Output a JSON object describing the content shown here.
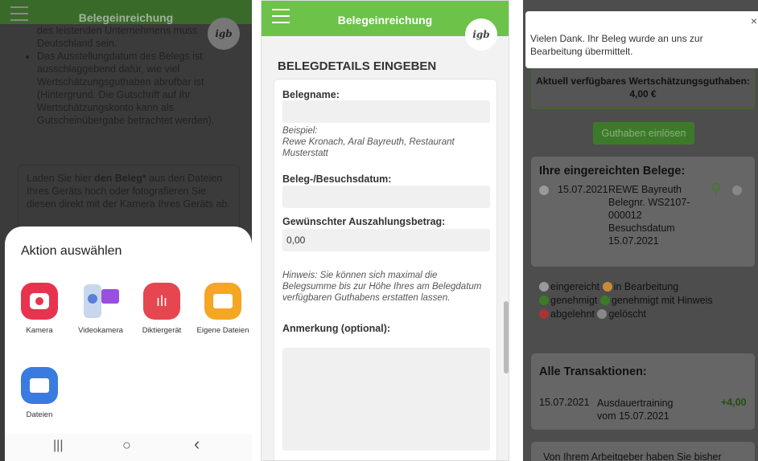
{
  "panel1": {
    "header_title": "Belegeinreichung",
    "logo_text": "igb",
    "bullet1_tail": "des leistenden Unternehmens muss Deutschland sein.",
    "bullet2": "Das Ausstellungdatum des Belegs ist ausschlaggebend dafür, wie viel Wertschätzungsguthaben abrufbar ist (Hintergrund: Die Gutschrift auf Ihr Wertschätzungskonto kann als Gutscheinübergabe betrachtet werden).",
    "upload_pre": "Laden Sie hier ",
    "upload_bold": "den Beleg*",
    "upload_post": " aus den Dateien Ihres Geräts hoch oder fotografieren Sie diesen direkt mit der Kamera Ihres Geräts ab.",
    "sheet_title": "Aktion auswählen",
    "apps": [
      {
        "label": "Kamera",
        "color": "#e8334f",
        "icon": "camera-icon"
      },
      {
        "label": "Videokamera",
        "color": "#9b7de6",
        "icon": "video-camera-icon"
      },
      {
        "label": "Diktiergerät",
        "color": "#e64650",
        "icon": "voice-recorder-icon"
      },
      {
        "label": "Eigene Dateien",
        "color": "#f5a623",
        "icon": "folder-icon"
      },
      {
        "label": "Dateien",
        "color": "#3a7be0",
        "icon": "files-icon"
      }
    ],
    "nav": {
      "recents": "|||",
      "home": "○",
      "back": "‹"
    }
  },
  "panel2": {
    "header_title": "Belegeinreichung",
    "logo_text": "igb",
    "heading": "BELEGDETAILS EINGEBEN",
    "belegname_label": "Belegname:",
    "belegname_value": "",
    "example_text": "Beispiel:\nRewe Kronach, Aral Bayreuth, Restaurant Musterstatt",
    "datum_label": "Beleg-/Besuchsdatum:",
    "datum_value": "",
    "betrag_label": "Gewünschter Auszahlungsbetrag:",
    "betrag_value": "0,00",
    "hinweis": "Hinweis: Sie können sich maximal die Belegsumme bis zur Höhe Ihres am Belegdatum verfügbaren Guthabens erstatten lassen.",
    "anmerkung_label": "Anmerkung (optional):",
    "anmerkung_value": ""
  },
  "panel3": {
    "toast_text": "Vielen Dank. Ihr Beleg wurde an uns zur Bearbeitung übermittelt.",
    "close": "×",
    "wert_text": "Aktuell verfügbares Wertschätzungsguthaben: 4,00 €",
    "einloesen": "Guthaben einlösen",
    "belege_title": "Ihre eingereichten Belege:",
    "beleg_date": "15.07.2021",
    "beleg_desc": "REWE Bayreuth Belegnr. WS2107-000012 Besuchsdatum 15.07.2021",
    "legend": {
      "eingereicht": "eingereicht",
      "bearbeitung": "in Bearbeitung",
      "genehmigt": "genehmigt",
      "genehmigt_hinweis": "genehmigt mit Hinweis",
      "abgelehnt": "abgelehnt",
      "geloescht": "gelöscht"
    },
    "trans_title": "Alle Transaktionen:",
    "trans_date": "15.07.2021",
    "trans_desc": "Ausdauertraining vom 15.07.2021",
    "trans_amount": "+4,00",
    "bottom_text": "Von Ihrem Arbeitgeber haben Sie bisher"
  }
}
